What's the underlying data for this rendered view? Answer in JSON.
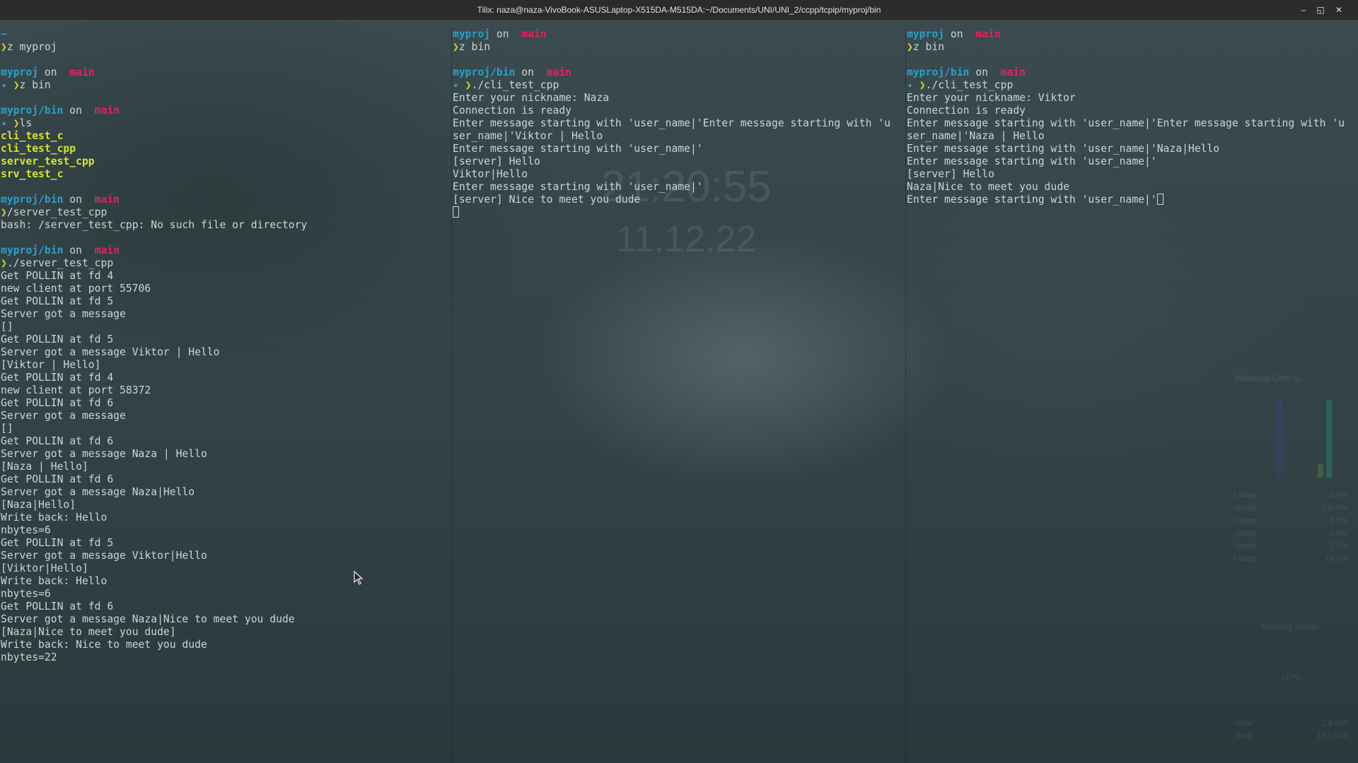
{
  "window": {
    "title": "Tilix: naza@naza-VivoBook-ASUSLaptop-X515DA-M515DA:~/Documents/UNI/UNI_2/ccpp/tcpip/myproj/bin",
    "minimize_glyph": "–",
    "maximize_glyph": "◱",
    "close_glyph": "✕"
  },
  "colors": {
    "dir": "#2aa1c9",
    "branch": "#e0245e",
    "arrow": "#d7d22a",
    "file": "#d7e32a",
    "text": "#cfd3d4"
  },
  "icons": {
    "branch": "branch-icon",
    "prompt_arrow": "chevron-right-icon",
    "star": "star-icon"
  },
  "prompt": {
    "on": "on",
    "branch": "main",
    "branch_glyph": "",
    "arrow_glyph": "❯",
    "star_glyph": "✦"
  },
  "panes": {
    "left": [
      {
        "t": "tilde",
        "text": "~"
      },
      {
        "t": "cmd",
        "star": false,
        "text": "z myproj"
      },
      {
        "t": "blank"
      },
      {
        "t": "prompt",
        "dir": "myproj"
      },
      {
        "t": "cmd",
        "star": true,
        "text": "z bin"
      },
      {
        "t": "blank"
      },
      {
        "t": "prompt",
        "dir": "myproj/bin"
      },
      {
        "t": "cmd",
        "star": true,
        "text": "ls"
      },
      {
        "t": "file",
        "text": "cli_test_c"
      },
      {
        "t": "file",
        "text": "cli_test_cpp"
      },
      {
        "t": "file",
        "text": "server_test_cpp"
      },
      {
        "t": "file",
        "text": "srv_test_c"
      },
      {
        "t": "blank"
      },
      {
        "t": "prompt",
        "dir": "myproj/bin"
      },
      {
        "t": "cmd",
        "star": false,
        "text": "/server_test_cpp"
      },
      {
        "t": "out",
        "text": "bash: /server_test_cpp: No such file or directory"
      },
      {
        "t": "blank"
      },
      {
        "t": "prompt",
        "dir": "myproj/bin"
      },
      {
        "t": "cmd",
        "star": false,
        "text": "./server_test_cpp"
      },
      {
        "t": "out",
        "text": "Get POLLIN at fd 4"
      },
      {
        "t": "out",
        "text": "new client at port 55706"
      },
      {
        "t": "out",
        "text": "Get POLLIN at fd 5"
      },
      {
        "t": "out",
        "text": "Server got a message"
      },
      {
        "t": "out",
        "text": "[]"
      },
      {
        "t": "out",
        "text": "Get POLLIN at fd 5"
      },
      {
        "t": "out",
        "text": "Server got a message Viktor | Hello"
      },
      {
        "t": "out",
        "text": "[Viktor | Hello]"
      },
      {
        "t": "out",
        "text": "Get POLLIN at fd 4"
      },
      {
        "t": "out",
        "text": "new client at port 58372"
      },
      {
        "t": "out",
        "text": "Get POLLIN at fd 6"
      },
      {
        "t": "out",
        "text": "Server got a message"
      },
      {
        "t": "out",
        "text": "[]"
      },
      {
        "t": "out",
        "text": "Get POLLIN at fd 6"
      },
      {
        "t": "out",
        "text": "Server got a message Naza | Hello"
      },
      {
        "t": "out",
        "text": "[Naza | Hello]"
      },
      {
        "t": "out",
        "text": "Get POLLIN at fd 6"
      },
      {
        "t": "out",
        "text": "Server got a message Naza|Hello"
      },
      {
        "t": "out",
        "text": "[Naza|Hello]"
      },
      {
        "t": "out",
        "text": "Write back: Hello"
      },
      {
        "t": "out",
        "text": "nbytes=6"
      },
      {
        "t": "out",
        "text": "Get POLLIN at fd 5"
      },
      {
        "t": "out",
        "text": "Server got a message Viktor|Hello"
      },
      {
        "t": "out",
        "text": "[Viktor|Hello]"
      },
      {
        "t": "out",
        "text": "Write back: Hello"
      },
      {
        "t": "out",
        "text": "nbytes=6"
      },
      {
        "t": "out",
        "text": "Get POLLIN at fd 6"
      },
      {
        "t": "out",
        "text": "Server got a message Naza|Nice to meet you dude"
      },
      {
        "t": "out",
        "text": "[Naza|Nice to meet you dude]"
      },
      {
        "t": "out",
        "text": "Write back: Nice to meet you dude"
      },
      {
        "t": "out",
        "text": "nbytes=22"
      }
    ],
    "middle": [
      {
        "t": "prompt",
        "dir": "myproj"
      },
      {
        "t": "cmd",
        "star": false,
        "text": "z bin"
      },
      {
        "t": "blank"
      },
      {
        "t": "prompt",
        "dir": "myproj/bin"
      },
      {
        "t": "cmd",
        "star": true,
        "text": "./cli_test_cpp"
      },
      {
        "t": "out",
        "text": "Enter your nickname: Naza"
      },
      {
        "t": "out",
        "text": "Connection is ready"
      },
      {
        "t": "out",
        "text": "Enter message starting with 'user_name|'Enter message starting with 'u"
      },
      {
        "t": "out",
        "text": "ser_name|'Viktor | Hello"
      },
      {
        "t": "out",
        "text": "Enter message starting with 'user_name|'"
      },
      {
        "t": "out",
        "text": "[server] Hello"
      },
      {
        "t": "out",
        "text": "Viktor|Hello"
      },
      {
        "t": "out",
        "text": "Enter message starting with 'user_name|'"
      },
      {
        "t": "out",
        "text": "[server] Nice to meet you dude"
      },
      {
        "t": "cursor",
        "text": ""
      }
    ],
    "right": [
      {
        "t": "prompt",
        "dir": "myproj"
      },
      {
        "t": "cmd",
        "star": false,
        "text": "z bin"
      },
      {
        "t": "blank"
      },
      {
        "t": "prompt",
        "dir": "myproj/bin"
      },
      {
        "t": "cmd",
        "star": true,
        "text": "./cli_test_cpp"
      },
      {
        "t": "out",
        "text": "Enter your nickname: Viktor"
      },
      {
        "t": "out",
        "text": "Connection is ready"
      },
      {
        "t": "out",
        "text": "Enter message starting with 'user_name|'Enter message starting with 'u"
      },
      {
        "t": "out",
        "text": "ser_name|'Naza | Hello"
      },
      {
        "t": "out",
        "text": "Enter message starting with 'user_name|'Naza|Hello"
      },
      {
        "t": "out",
        "text": "Enter message starting with 'user_name|'"
      },
      {
        "t": "out",
        "text": "[server] Hello"
      },
      {
        "t": "out",
        "text": "Naza|Nice to meet you dude"
      },
      {
        "t": "cursor",
        "text": "Enter message starting with 'user_name|'"
      }
    ]
  },
  "wallpaper": {
    "clock_time": "21:20:55",
    "clock_date": "11.12.22"
  },
  "widget": {
    "title": "Individual Core U...",
    "usage_rows": [
      {
        "label": "Usage",
        "value": "2.0%"
      },
      {
        "label": "Usage",
        "value": "100.0%"
      },
      {
        "label": "Usage",
        "value": "3.0%"
      },
      {
        "label": "Usage",
        "value": "2.0%"
      },
      {
        "label": "Usage",
        "value": "7.1%"
      },
      {
        "label": "Usage",
        "value": "14.3%"
      }
    ],
    "memory_title": "Memory Usage",
    "memory_percent": "16.7%",
    "memory_rows": [
      {
        "label": "Used",
        "value": "2.9 GiB"
      },
      {
        "label": "Total",
        "value": "17.5 GiB"
      }
    ]
  }
}
